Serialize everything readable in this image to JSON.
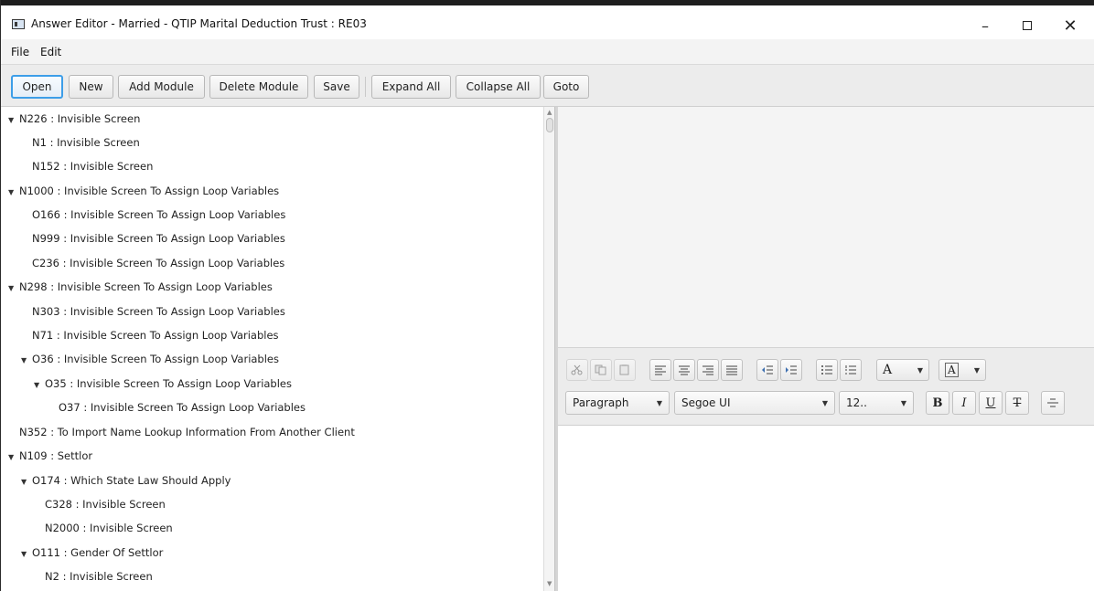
{
  "window": {
    "title": "Answer Editor - Married - QTIP Marital Deduction Trust : RE03",
    "minimize": "–",
    "close": "✕"
  },
  "menu": [
    "File",
    "Edit"
  ],
  "toolbar": {
    "open": "Open",
    "new": "New",
    "add_module": "Add Module",
    "delete_module": "Delete Module",
    "save": "Save",
    "expand_all": "Expand All",
    "collapse_all": "Collapse All",
    "goto": "Goto"
  },
  "tree": [
    {
      "label": "N226 : Invisible Screen",
      "expanded": true
    },
    {
      "label": "N1 : Invisible Screen",
      "expanded": false
    },
    {
      "label": "N152 : Invisible Screen",
      "expanded": false
    },
    {
      "label": "N1000 : Invisible Screen To Assign Loop Variables",
      "expanded": true
    },
    {
      "label": "O166 : Invisible Screen To Assign Loop Variables",
      "expanded": false
    },
    {
      "label": "N999 : Invisible Screen To Assign Loop Variables",
      "expanded": false
    },
    {
      "label": "C236 : Invisible Screen To Assign Loop Variables",
      "expanded": false
    },
    {
      "label": "N298 : Invisible Screen To Assign Loop Variables",
      "expanded": true
    },
    {
      "label": "N303 : Invisible Screen To Assign Loop Variables",
      "expanded": false
    },
    {
      "label": "N71 : Invisible Screen To Assign Loop Variables",
      "expanded": false
    },
    {
      "label": "O36 : Invisible Screen To Assign Loop Variables",
      "expanded": true
    },
    {
      "label": "O35 : Invisible Screen To Assign Loop Variables",
      "expanded": true
    },
    {
      "label": "O37 : Invisible Screen To Assign Loop Variables",
      "expanded": false
    },
    {
      "label": "N352 : To Import Name Lookup Information From Another Client",
      "expanded": false
    },
    {
      "label": "N109 : Settlor",
      "expanded": true
    },
    {
      "label": "O174 : Which State Law Should Apply",
      "expanded": true
    },
    {
      "label": "C328 : Invisible Screen",
      "expanded": false
    },
    {
      "label": "N2000 : Invisible Screen",
      "expanded": false
    },
    {
      "label": "O111 : Gender Of Settlor",
      "expanded": true
    },
    {
      "label": "N2 : Invisible Screen",
      "expanded": false
    }
  ],
  "editor": {
    "paragraph_style": "Paragraph",
    "font_family": "Segoe UI",
    "font_size": "12..",
    "bold": "B",
    "italic": "I",
    "underline": "U",
    "strikethrough": "T",
    "text_color": "A",
    "background_color": "A",
    "icons": [
      "cut-icon",
      "copy-icon",
      "paste-icon",
      "align-left-icon",
      "align-center-icon",
      "align-right-icon",
      "align-justify-icon",
      "outdent-icon",
      "indent-icon",
      "bullet-list-icon",
      "numbered-list-icon",
      "text-color-icon",
      "background-color-icon",
      "insert-rule-icon"
    ]
  },
  "colors": {
    "focus": "#3d9ee8",
    "pane_bg": "#f4f4f4",
    "toolbar_bg": "#ececec"
  }
}
